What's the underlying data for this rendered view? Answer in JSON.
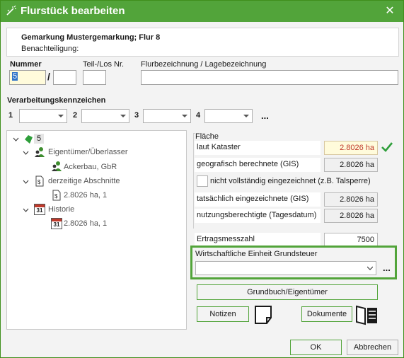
{
  "window": {
    "title": "Flurstück bearbeiten",
    "close_glyph": "✕",
    "icon": "wand-icon"
  },
  "header": {
    "title": "Gemarkung Mustergemarkung; Flur 8",
    "subtitle": "Benachteiligung:"
  },
  "parcel": {
    "nummer_label": "Nummer",
    "nummer_value": "5",
    "separator": "/",
    "teil_value": "",
    "teil_label": "Teil-/Los Nr.",
    "los_value": "",
    "flurbez_label": "Flurbezeichnung / Lagebezeichnung",
    "flurbez_value": ""
  },
  "verarbeitung": {
    "label": "Verarbeitungskennzeichen",
    "combos": [
      {
        "index": "1",
        "value": ""
      },
      {
        "index": "2",
        "value": ""
      },
      {
        "index": "3",
        "value": ""
      },
      {
        "index": "4",
        "value": ""
      }
    ],
    "more": "..."
  },
  "tree": {
    "root": "5",
    "owner_group": "Eigentümer/Überlasser",
    "owner": "Ackerbau, GbR",
    "sections_group": "derzeitige Abschnitte",
    "section_item": "2.8026 ha, 1",
    "history_group": "Historie",
    "history_item": "2.8026 ha, 1",
    "history_icon_text": "31"
  },
  "flaeche": {
    "group_label": "Fläche",
    "laut_kataster_label": "laut Kataster",
    "laut_kataster_value": "2.8026 ha",
    "geografisch_label": "geografisch berechnete (GIS)",
    "geografisch_value": "2.8026 ha",
    "nicht_vollstaendig_label": "nicht vollständig eingezeichnet (z.B. Talsperre)",
    "tatsaechlich_label": "tatsächlich eingezeichnete (GIS)",
    "tatsaechlich_value": "2.8026 ha",
    "nutzung_label": "nutzungsberechtigte (Tagesdatum)",
    "nutzung_value": "2.8026 ha"
  },
  "ertrag": {
    "label": "Ertragsmesszahl",
    "value": "7500"
  },
  "wirtschaft": {
    "label": "Wirtschaftliche Einheit Grundsteuer",
    "value": "",
    "more": "..."
  },
  "buttons": {
    "grundbuch": "Grundbuch/Eigentümer",
    "notizen": "Notizen",
    "dokumente": "Dokumente",
    "ok": "OK",
    "abbrechen": "Abbrechen"
  },
  "colors": {
    "accent_green": "#52a43a",
    "kataster_text": "#c0392b",
    "check_green": "#2e9e3a"
  }
}
